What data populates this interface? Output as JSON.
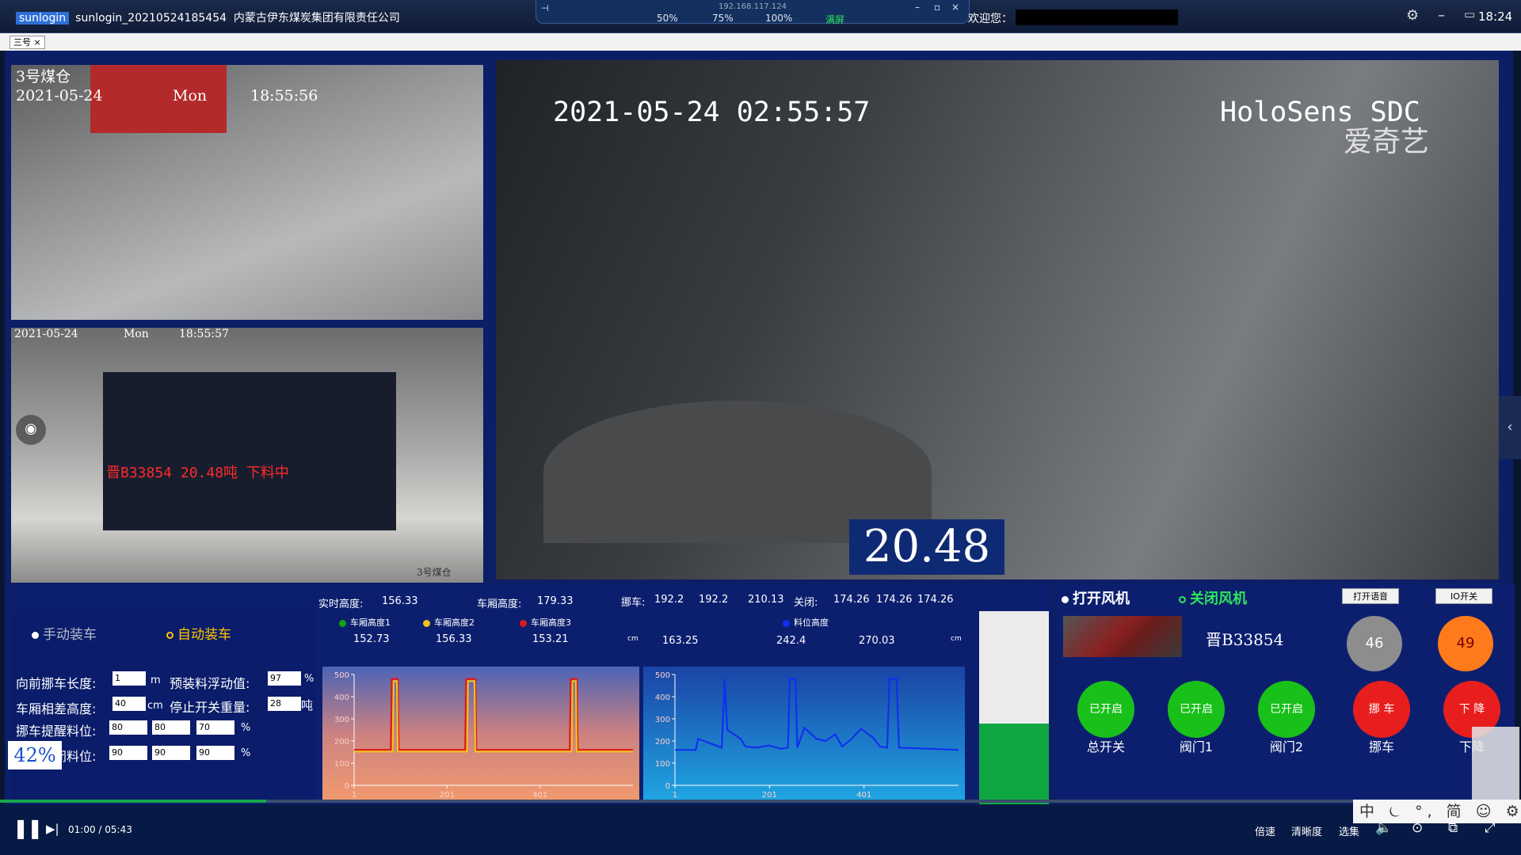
{
  "window": {
    "app": "sunlogin",
    "title": "sunlogin_20210524185454",
    "company": "内蒙古伊东煤炭集团有限责任公司",
    "ip": "192.168.117.124",
    "zoom": [
      "50%",
      "75%",
      "100%",
      "满屏"
    ],
    "welcome": "欢迎您：",
    "clock": "18:24"
  },
  "tab": {
    "label": "三号",
    "close": "×"
  },
  "cam1": {
    "title": "3号煤仓",
    "date": "2021-05-24",
    "day": "Mon",
    "time": "18:55:56"
  },
  "cam2": {
    "date": "2021-05-24",
    "day": "Mon",
    "time": "18:55:57",
    "sign": "晋B33854 20.48吨 下料中",
    "corner": "3号煤仓"
  },
  "cam3": {
    "datetime": "2021-05-24  02:55:57",
    "brand": "HoloSens SDC",
    "overlay": "爱奇艺",
    "weight": "20.48"
  },
  "mode": {
    "manual": "手动装车",
    "auto": "自动装车"
  },
  "params": {
    "row1_label": "向前挪车长度:",
    "row1_value": "1",
    "row1_unit": "m",
    "row1b_label": "预装料浮动值:",
    "row1b_value": "97",
    "row1b_unit": "%",
    "row2_label": "车厢相差高度:",
    "row2_value": "40",
    "row2_unit": "cm",
    "row2b_label": "停止开关重量:",
    "row2b_value": "28",
    "row2b_unit": "吨",
    "row3_label": "挪车提醒料位:",
    "row3_values": [
      "80",
      "80",
      "70"
    ],
    "row3_unit": "%",
    "row4_label": "阀门关闭料位:",
    "row4_values": [
      "90",
      "90",
      "90"
    ],
    "row4_unit": "%"
  },
  "readout": {
    "realtime_label": "实时高度:",
    "realtime_value": "156.33",
    "carriage_label": "车厢高度:",
    "carriage_value": "179.33",
    "move_label": "挪车:",
    "move_values": [
      "192.2",
      "192.2",
      "210.13"
    ],
    "close_label": "关闭:",
    "close_values": [
      "174.26",
      "174.26",
      "174.26"
    ],
    "legend1": "车厢高度1",
    "legend2": "车厢高度2",
    "legend3": "车厢高度3",
    "legend4": "料位高度",
    "v1": "152.73",
    "v2": "156.33",
    "v3": "153.21",
    "unit": "cm",
    "v4": "163.25",
    "v5": "242.4",
    "v6": "270.03"
  },
  "chart_data": [
    {
      "type": "line",
      "yticks": [
        "500",
        "400",
        "300",
        "200",
        "100",
        "0"
      ],
      "xticks": [
        "1",
        "201",
        "401"
      ],
      "ylim": [
        0,
        500
      ],
      "xlim": [
        1,
        601
      ],
      "series": [
        {
          "name": "车厢高度1",
          "color": "#e01818",
          "values": [
            [
              1,
              160
            ],
            [
              80,
              160
            ],
            [
              82,
              480
            ],
            [
              95,
              480
            ],
            [
              97,
              160
            ],
            [
              240,
              160
            ],
            [
              242,
              480
            ],
            [
              262,
              480
            ],
            [
              264,
              160
            ],
            [
              465,
              160
            ],
            [
              467,
              480
            ],
            [
              480,
              480
            ],
            [
              482,
              160
            ],
            [
              601,
              160
            ]
          ]
        },
        {
          "name": "车厢高度2",
          "color": "#f0c020",
          "values": [
            [
              1,
              152
            ],
            [
              84,
              152
            ],
            [
              86,
              470
            ],
            [
              93,
              470
            ],
            [
              95,
              152
            ],
            [
              244,
              152
            ],
            [
              246,
              470
            ],
            [
              260,
              470
            ],
            [
              262,
              152
            ],
            [
              469,
              152
            ],
            [
              471,
              470
            ],
            [
              478,
              470
            ],
            [
              480,
              152
            ],
            [
              601,
              152
            ]
          ]
        }
      ]
    },
    {
      "type": "line",
      "yticks": [
        "500",
        "400",
        "300",
        "200",
        "100",
        "0"
      ],
      "xticks": [
        "1",
        "201",
        "401"
      ],
      "ylim": [
        0,
        500
      ],
      "xlim": [
        1,
        601
      ],
      "series": [
        {
          "name": "料位高度",
          "color": "#1030ee",
          "values": [
            [
              1,
              160
            ],
            [
              45,
              160
            ],
            [
              50,
              210
            ],
            [
              100,
              170
            ],
            [
              106,
              480
            ],
            [
              112,
              250
            ],
            [
              140,
              210
            ],
            [
              150,
              175
            ],
            [
              175,
              170
            ],
            [
              200,
              180
            ],
            [
              225,
              165
            ],
            [
              240,
              170
            ],
            [
              244,
              480
            ],
            [
              256,
              480
            ],
            [
              260,
              170
            ],
            [
              275,
              260
            ],
            [
              300,
              210
            ],
            [
              320,
              200
            ],
            [
              340,
              230
            ],
            [
              355,
              175
            ],
            [
              372,
              205
            ],
            [
              395,
              255
            ],
            [
              420,
              215
            ],
            [
              435,
              175
            ],
            [
              450,
              170
            ],
            [
              455,
              480
            ],
            [
              470,
              480
            ],
            [
              475,
              170
            ],
            [
              601,
              160
            ]
          ]
        }
      ]
    }
  ],
  "gauge": {
    "label": "42%",
    "percent": 42
  },
  "right": {
    "fan_on": "打开风机",
    "fan_off": "关闭风机",
    "voice_btn": "打开语音",
    "io_btn": "IO开关",
    "plate": "晋B33854",
    "level1": "46",
    "level2": "49",
    "btn1": "已开启",
    "btn2": "已开启",
    "btn3": "已开启",
    "btn4": "挪 车",
    "btn5": "下 降",
    "lab1": "总开关",
    "lab2": "阀门1",
    "lab3": "阀门2",
    "lab4": "挪车",
    "lab5": "下降",
    "colors": {
      "green": "#19c01a",
      "red": "#e81e1e",
      "gray": "#8d8d8d",
      "orange": "#ff7a1a"
    }
  },
  "player": {
    "time": "01:00 / 05:43",
    "speed": "倍速",
    "quality": "清晰度",
    "episodes": "选集",
    "progress": 0.175
  },
  "ime": {
    "text": "中 ⏾ °, 简 ☺ ⚙"
  }
}
